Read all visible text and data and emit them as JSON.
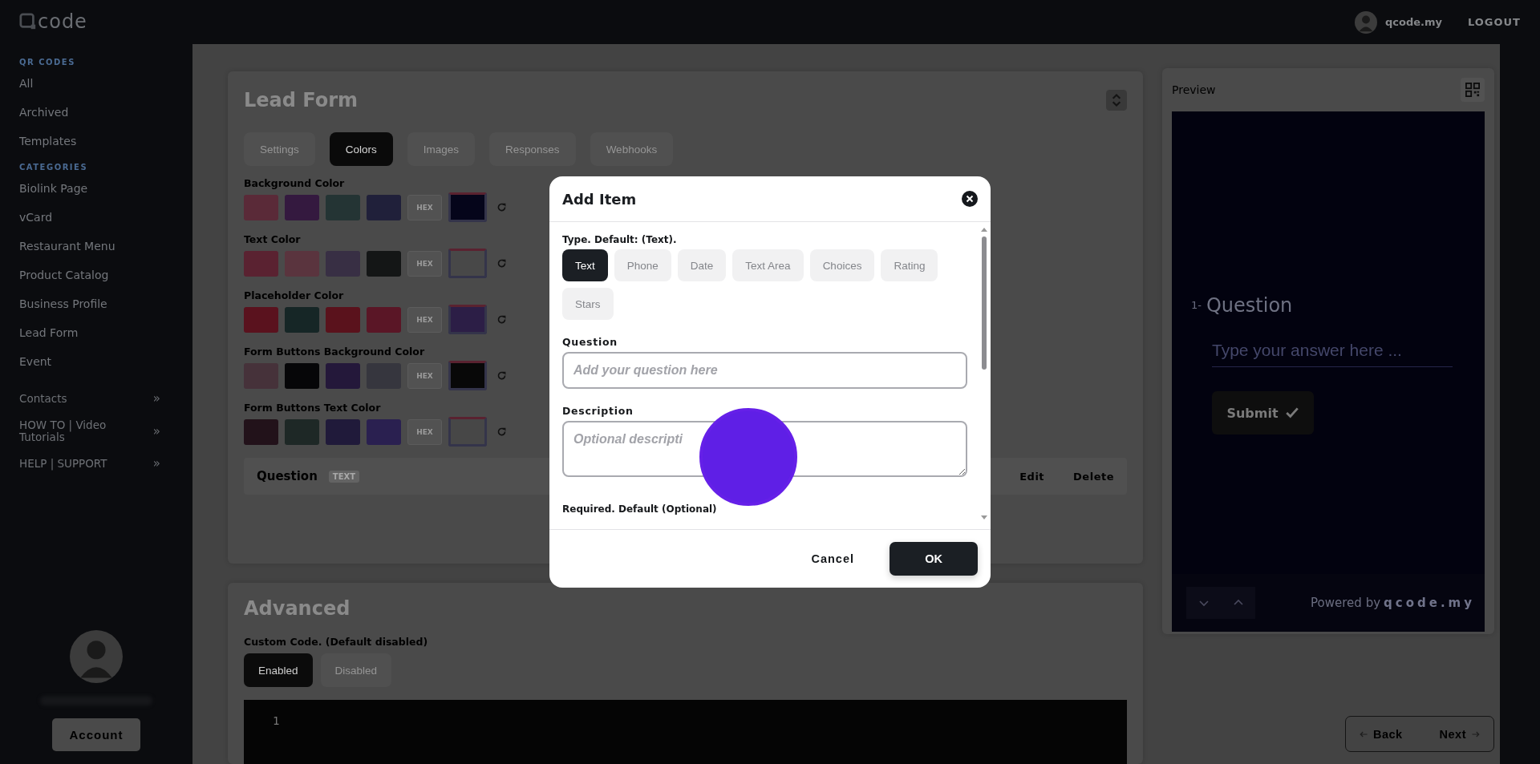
{
  "top_bar": {
    "user_name": "qcode.my",
    "logout": "LOGOUT"
  },
  "sidebar": {
    "logo": "code",
    "sections": [
      {
        "heading": "QR CODES",
        "items": [
          {
            "label": "All"
          },
          {
            "label": "Archived"
          },
          {
            "label": "Templates"
          }
        ]
      },
      {
        "heading": "CATEGORIES",
        "items": [
          {
            "label": "Biolink Page"
          },
          {
            "label": "vCard"
          },
          {
            "label": "Restaurant Menu"
          },
          {
            "label": "Product Catalog"
          },
          {
            "label": "Business Profile"
          },
          {
            "label": "Lead Form"
          },
          {
            "label": "Event"
          }
        ]
      }
    ],
    "links": [
      {
        "label": "Contacts",
        "chevron": "»"
      },
      {
        "label": "HOW TO | Video Tutorials",
        "chevron": "»"
      },
      {
        "label": "HELP | SUPPORT",
        "chevron": "»"
      }
    ],
    "account_button": "Account"
  },
  "editor": {
    "title": "Lead Form",
    "tabs": [
      {
        "label": "Settings",
        "selected": false
      },
      {
        "label": "Colors",
        "selected": true
      },
      {
        "label": "Images",
        "selected": false
      },
      {
        "label": "Responses",
        "selected": false
      },
      {
        "label": "Webhooks",
        "selected": false
      }
    ],
    "color_groups": [
      {
        "label": "Background Color",
        "hex_placeholder": "HEX",
        "swatches": [
          {
            "kind": "preset",
            "color": "#5a2a38"
          },
          {
            "kind": "preset",
            "color": "#34193f"
          },
          {
            "kind": "preset",
            "color": "#243434"
          },
          {
            "kind": "preset",
            "color": "#20203a"
          },
          {
            "kind": "picker",
            "color": "#05051a"
          }
        ]
      },
      {
        "label": "Text Color",
        "hex_placeholder": "HEX",
        "swatches": [
          {
            "kind": "preset",
            "color": "#5a2231"
          },
          {
            "kind": "preset",
            "color": "#5a343e"
          },
          {
            "kind": "preset",
            "color": "#382f44"
          },
          {
            "kind": "preset",
            "color": "#141616"
          },
          {
            "kind": "picker",
            "color": "#484848"
          }
        ]
      },
      {
        "label": "Placeholder Color",
        "hex_placeholder": "HEX",
        "swatches": [
          {
            "kind": "preset",
            "color": "#5a121e"
          },
          {
            "kind": "preset",
            "color": "#162626"
          },
          {
            "kind": "preset",
            "color": "#5a121c"
          },
          {
            "kind": "preset",
            "color": "#5a1626"
          },
          {
            "kind": "picker",
            "color": "#2c1e46"
          }
        ]
      },
      {
        "label": "Form Buttons Background Color",
        "hex_placeholder": "HEX",
        "swatches": [
          {
            "kind": "preset",
            "color": "#46323a"
          },
          {
            "kind": "preset",
            "color": "#060608"
          },
          {
            "kind": "preset",
            "color": "#24183a"
          },
          {
            "kind": "preset",
            "color": "#36363e"
          },
          {
            "kind": "picker",
            "color": "#080808"
          }
        ]
      },
      {
        "label": "Form Buttons Text Color",
        "hex_placeholder": "HEX",
        "swatches": [
          {
            "kind": "preset",
            "color": "#22121a"
          },
          {
            "kind": "preset",
            "color": "#1e2826"
          },
          {
            "kind": "preset",
            "color": "#201a3a"
          },
          {
            "kind": "preset",
            "color": "#2a2050"
          },
          {
            "kind": "picker",
            "color": "#474747"
          }
        ]
      }
    ],
    "items": [
      {
        "question": "Question",
        "type": "TEXT",
        "actions": [
          "Edit",
          "Delete"
        ]
      }
    ]
  },
  "advanced": {
    "title": "Advanced",
    "custom_code_label": "Custom Code. (Default disabled)",
    "options": [
      {
        "label": "Enabled",
        "selected": true
      },
      {
        "label": "Disabled",
        "selected": false
      }
    ],
    "code_lines": [
      "1"
    ]
  },
  "preview": {
    "title": "Preview",
    "question_number": "1-",
    "question": "Question",
    "answer_placeholder": "Type your answer here ...",
    "submit": "Submit",
    "powered_by": "Powered by",
    "brand": "qcode.my"
  },
  "navigation": {
    "back": "Back",
    "next": "Next"
  },
  "modal": {
    "title": "Add Item",
    "type_label": "Type. Default: (Text).",
    "types": [
      {
        "label": "Text",
        "selected": true
      },
      {
        "label": "Phone",
        "selected": false
      },
      {
        "label": "Date",
        "selected": false
      },
      {
        "label": "Text Area",
        "selected": false
      },
      {
        "label": "Choices",
        "selected": false
      },
      {
        "label": "Rating",
        "selected": false
      },
      {
        "label": "Stars",
        "selected": false
      }
    ],
    "question_label": "Question",
    "question_placeholder": "Add your question here",
    "description_label": "Description",
    "description_placeholder": "Optional descripti",
    "required_label": "Required. Default (Optional)",
    "cancel": "Cancel",
    "ok": "OK"
  }
}
